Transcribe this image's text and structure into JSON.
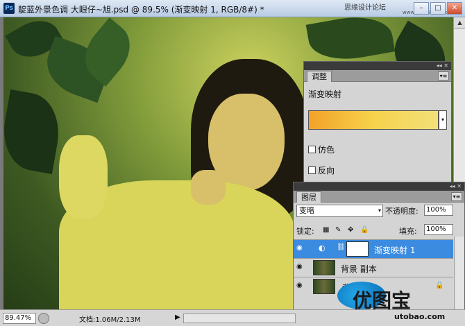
{
  "window": {
    "app_icon": "Ps",
    "title": "靛蓝外景色调 大眼仔~旭.psd @ 89.5% (渐变映射 1, RGB/8#) *",
    "watermark": "思缘设计论坛",
    "watermark_url": "www.MISSVUAN.com",
    "buttons": [
      "minimize-icon",
      "maximize-icon",
      "close-icon"
    ]
  },
  "status": {
    "zoom": "89.47%",
    "doc_info": "文档:1.06M/2.13M"
  },
  "adjustments": {
    "tab": "调整",
    "name": "渐变映射",
    "gradient_colors": [
      "#f3a22a",
      "#f7d24b",
      "#f2e07a"
    ],
    "dither_label": "仿色",
    "reverse_label": "反向"
  },
  "layers": {
    "tab": "图层",
    "blend_mode": "变暗",
    "opacity_label": "不透明度:",
    "opacity_value": "100%",
    "lock_label": "锁定:",
    "fill_label": "填充:",
    "fill_value": "100%",
    "items": [
      {
        "name": "渐变映射 1",
        "selected": true
      },
      {
        "name": "背景 副本",
        "selected": false
      },
      {
        "name": "背景",
        "selected": false
      }
    ],
    "bottom_icons": [
      "link-icon",
      "fx-icon",
      "mask-icon"
    ]
  },
  "brand": {
    "name": "优图宝",
    "url": "utobao.com"
  }
}
